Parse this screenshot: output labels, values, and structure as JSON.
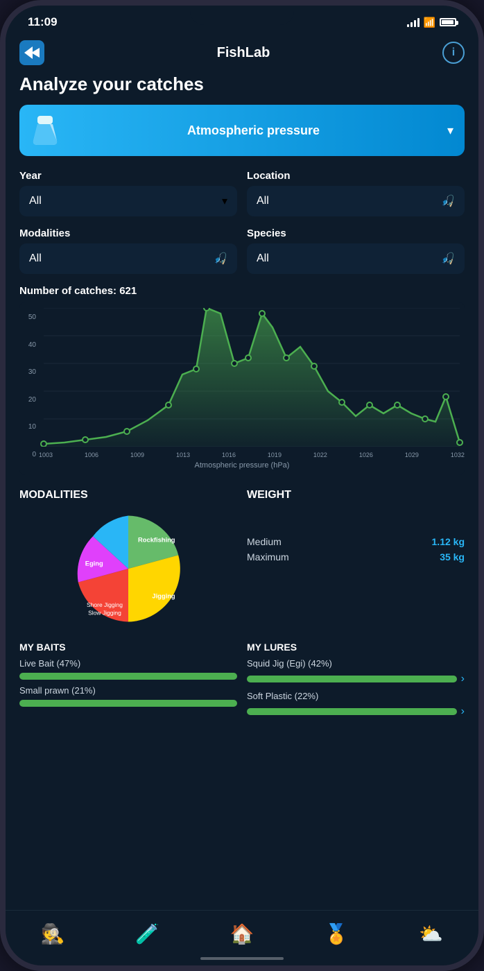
{
  "status": {
    "time": "11:09"
  },
  "header": {
    "title": "FishLab",
    "info_label": "i"
  },
  "page": {
    "title": "Analyze your catches",
    "pressure_label": "Atmospheric pressure"
  },
  "filters": {
    "year": {
      "label": "Year",
      "value": "All"
    },
    "location": {
      "label": "Location",
      "value": "All"
    },
    "modalities": {
      "label": "Modalities",
      "value": "All"
    },
    "species": {
      "label": "Species",
      "value": "All"
    }
  },
  "chart": {
    "catches_label": "Number of catches: 621",
    "x_label": "Atmospheric pressure (hPa)",
    "x_ticks": [
      "1003",
      "1006",
      "1009",
      "1013",
      "1016",
      "1019",
      "1022",
      "1026",
      "1029",
      "1032"
    ],
    "y_max": 50,
    "y_ticks": [
      "50",
      "40",
      "30",
      "20",
      "10",
      "0"
    ]
  },
  "modalities": {
    "title": "MODALITIES",
    "segments": [
      {
        "label": "Rockfishing",
        "color": "#ffd600",
        "percent": 28
      },
      {
        "label": "Jigging",
        "color": "#f44336",
        "percent": 26
      },
      {
        "label": "Shore Jigging",
        "color": "#e040fb",
        "percent": 15
      },
      {
        "label": "Slow Jigging",
        "color": "#29b6f6",
        "percent": 10
      },
      {
        "label": "Eging",
        "color": "#66bb6a",
        "percent": 21
      }
    ]
  },
  "weight": {
    "title": "WEIGHT",
    "medium_label": "Medium",
    "medium_value": "1.12 kg",
    "maximum_label": "Maximum",
    "maximum_value": "35 kg"
  },
  "baits": {
    "title": "MY BAITS",
    "items": [
      {
        "label": "Live Bait (47%)",
        "bar_color": "#4caf50",
        "bar_width": "70%"
      },
      {
        "label": "Small prawn (21%)",
        "bar_color": "#4caf50",
        "bar_width": "35%"
      }
    ]
  },
  "lures": {
    "title": "MY LURES",
    "items": [
      {
        "label": "Squid Jig (Egi) (42%)",
        "bar_color": "#4caf50",
        "bar_width": "65%"
      },
      {
        "label": "Soft Plastic (22%)",
        "bar_color": "#4caf50",
        "bar_width": "36%"
      }
    ]
  },
  "nav": {
    "items": [
      {
        "icon": "👤",
        "label": "profile",
        "active": false
      },
      {
        "icon": "🧪",
        "label": "analyze",
        "active": true
      },
      {
        "icon": "🏠",
        "label": "home",
        "active": false
      },
      {
        "icon": "⭐",
        "label": "favorites",
        "active": false
      },
      {
        "icon": "☁️",
        "label": "weather",
        "active": false
      }
    ]
  }
}
